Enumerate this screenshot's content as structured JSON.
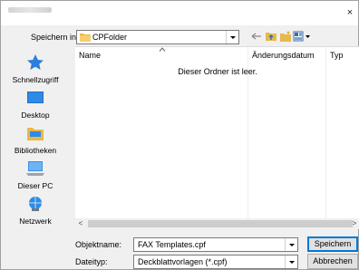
{
  "window": {
    "close_glyph": "×"
  },
  "toolbar": {
    "location_label": "Speichern in:",
    "location_value": "CPFolder",
    "icons": [
      "back-icon",
      "up-folder-icon",
      "new-folder-icon",
      "view-menu-icon"
    ]
  },
  "sidebar": {
    "items": [
      {
        "label": "Schnellzugriff",
        "icon": "star-icon"
      },
      {
        "label": "Desktop",
        "icon": "desktop-icon"
      },
      {
        "label": "Bibliotheken",
        "icon": "libraries-icon"
      },
      {
        "label": "Dieser PC",
        "icon": "computer-icon"
      },
      {
        "label": "Netzwerk",
        "icon": "network-icon"
      }
    ]
  },
  "filelist": {
    "columns": [
      "Name",
      "Änderungsdatum",
      "Typ"
    ],
    "empty_message": "Dieser Ordner ist leer."
  },
  "scrollbar": {
    "left_glyph": "<",
    "right_glyph": ">"
  },
  "form": {
    "filename_label": "Objektname:",
    "filename_value": "FAX Templates.cpf",
    "filetype_label": "Dateityp:",
    "filetype_value": "Deckblattvorlagen (*.cpf)",
    "save_label": "Speichern",
    "cancel_label": "Abbrechen"
  },
  "colors": {
    "accent": "#0078d7",
    "folder": "#e8b84a"
  }
}
